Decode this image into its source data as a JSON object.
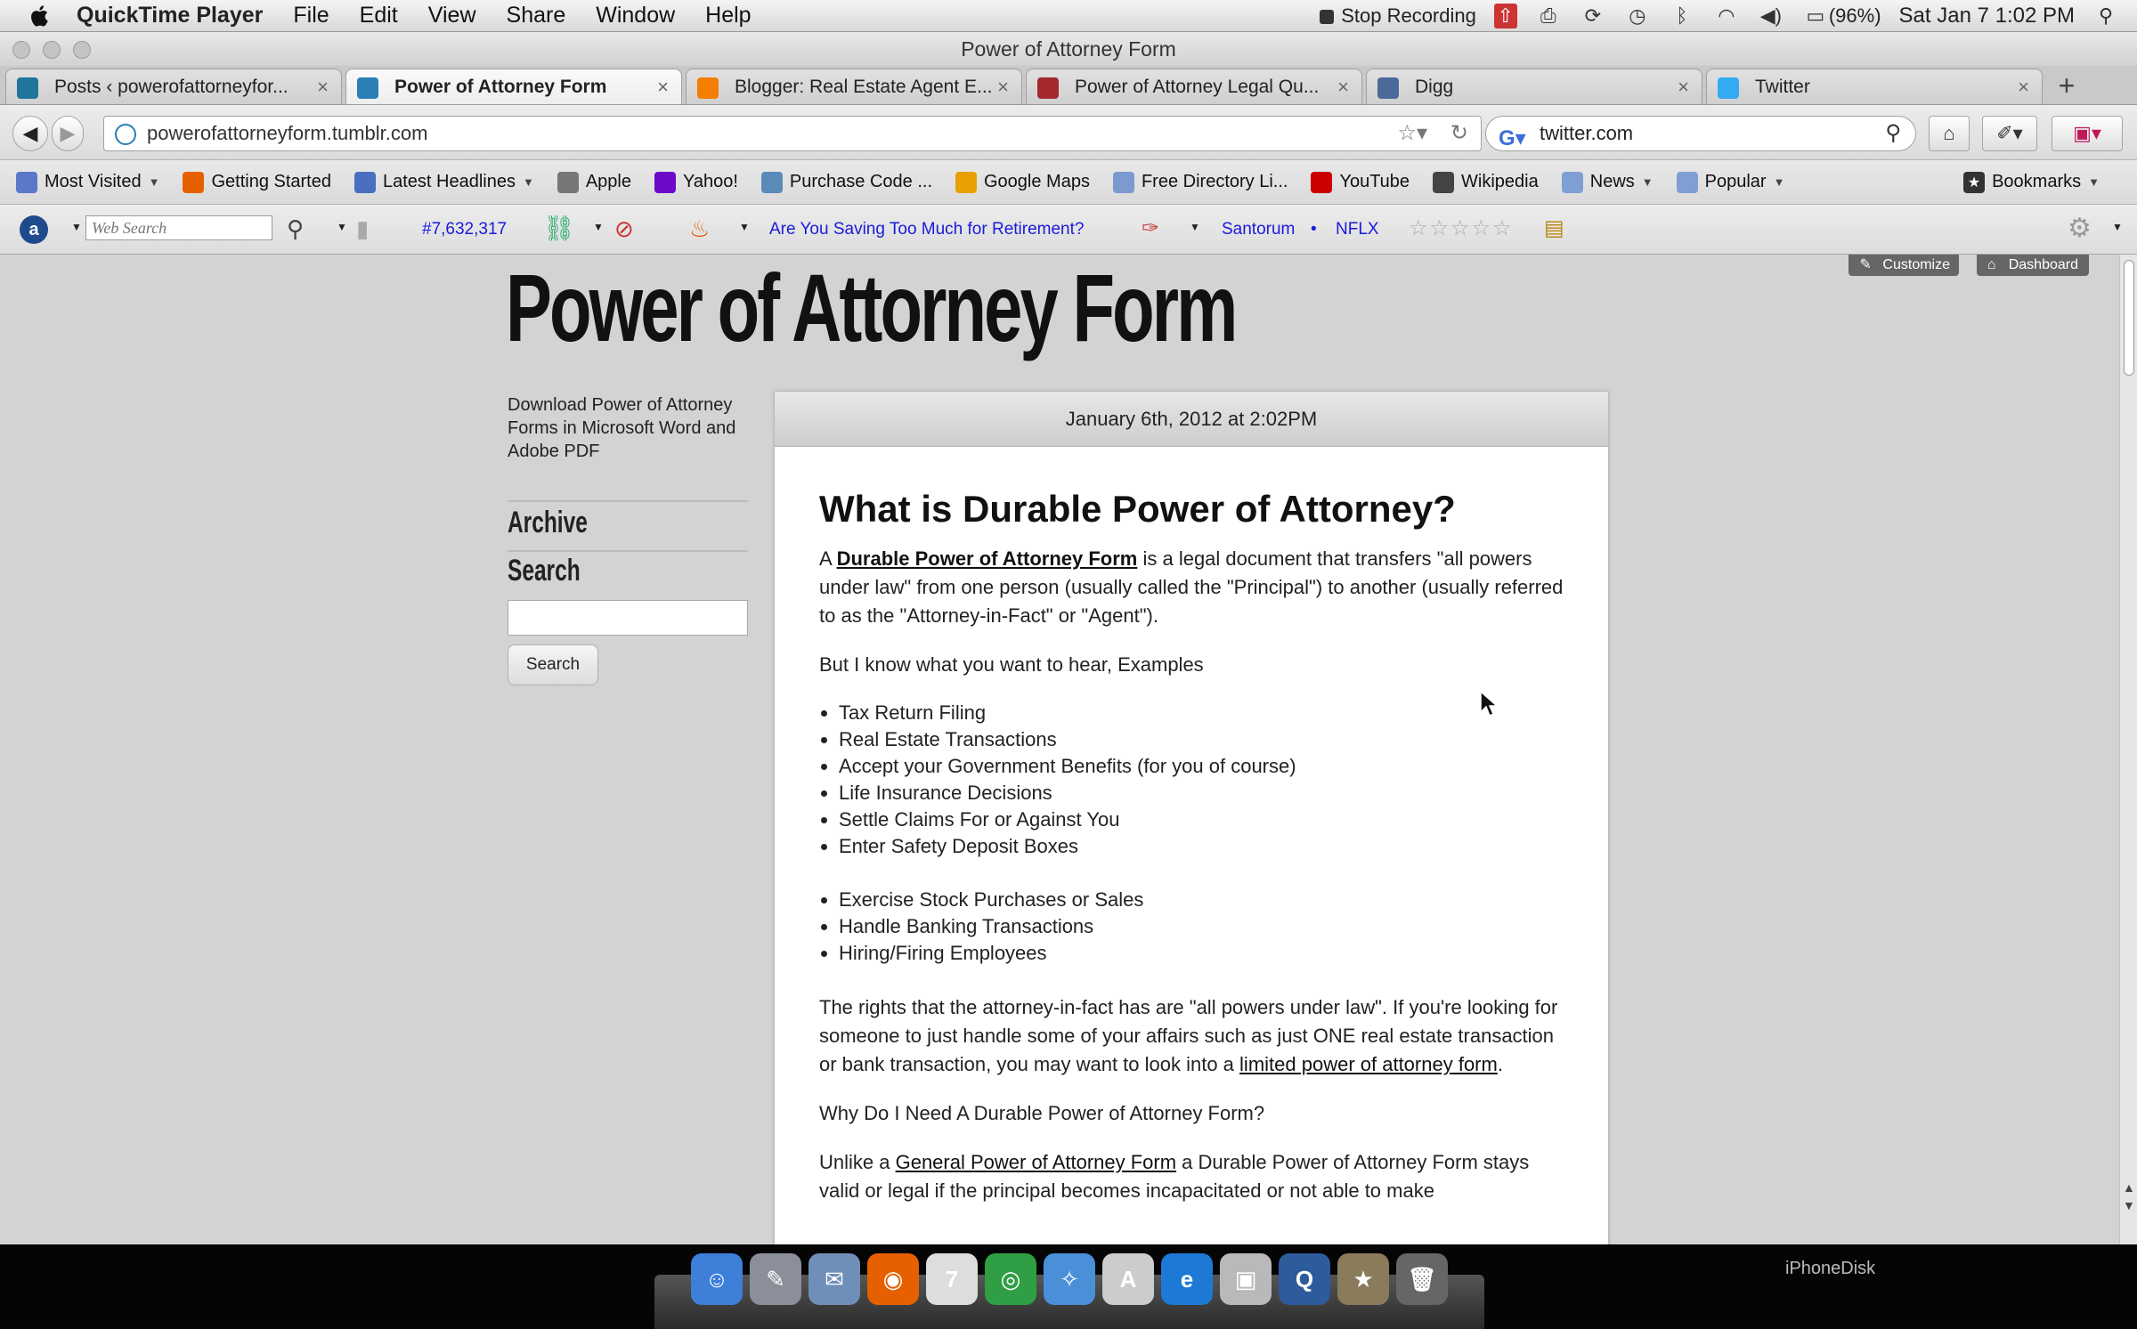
{
  "menubar": {
    "app": "QuickTime Player",
    "items": [
      "File",
      "Edit",
      "View",
      "Share",
      "Window",
      "Help"
    ],
    "stop_recording": "Stop Recording",
    "battery": "(96%)",
    "clock": "Sat Jan 7  1:02 PM"
  },
  "window": {
    "title": "Power of Attorney Form"
  },
  "tabs": [
    {
      "label": "Posts ‹ powerofattorneyfor...",
      "icon": "wordpress-icon",
      "color": "#21759b"
    },
    {
      "label": "Power of Attorney Form",
      "icon": "tumblr-loading-icon",
      "color": "#2a7fb5",
      "active": true
    },
    {
      "label": "Blogger: Real Estate Agent E...",
      "icon": "blogger-icon",
      "color": "#f57d00"
    },
    {
      "label": "Power of Attorney Legal Qu...",
      "icon": "legal-icon",
      "color": "#a4282c"
    },
    {
      "label": "Digg",
      "icon": "digg-icon",
      "color": "#4b6a9a"
    },
    {
      "label": "Twitter",
      "icon": "twitter-icon",
      "color": "#33aaf2"
    }
  ],
  "nav": {
    "url": "powerofattorneyform.tumblr.com",
    "search_value": "twitter.com"
  },
  "bookmarks": [
    {
      "label": "Most Visited",
      "icon": "most-visited-icon",
      "color": "#5a78c8",
      "dropdown": true
    },
    {
      "label": "Getting Started",
      "icon": "firefox-icon",
      "color": "#e66000",
      "dropdown": false
    },
    {
      "label": "Latest Headlines",
      "icon": "rss-icon",
      "color": "#4a6fc0",
      "dropdown": true
    },
    {
      "label": "Apple",
      "icon": "apple-icon",
      "color": "#777777",
      "dropdown": false
    },
    {
      "label": "Yahoo!",
      "icon": "yahoo-icon",
      "color": "#6b0ac9",
      "dropdown": false
    },
    {
      "label": "Purchase Code ...",
      "icon": "arrow-icon",
      "color": "#5a8ab8",
      "dropdown": false
    },
    {
      "label": "Google Maps",
      "icon": "map-pin-icon",
      "color": "#e8a000",
      "dropdown": false
    },
    {
      "label": "Free Directory Li...",
      "icon": "page-icon",
      "color": "#7a9ad0",
      "dropdown": false
    },
    {
      "label": "YouTube",
      "icon": "youtube-icon",
      "color": "#cc0000",
      "dropdown": false
    },
    {
      "label": "Wikipedia",
      "icon": "wikipedia-icon",
      "color": "#444444",
      "dropdown": false
    },
    {
      "label": "News",
      "icon": "folder-icon",
      "color": "#7f9fd3",
      "dropdown": true
    },
    {
      "label": "Popular",
      "icon": "folder-icon",
      "color": "#7f9fd3",
      "dropdown": true
    }
  ],
  "bookmarks_menu": "Bookmarks",
  "addonbar": {
    "search_placeholder": "Web Search",
    "rank": "#7,632,317",
    "ad_link": "Are You Saving Too Much for Retirement?",
    "link1": "Santorum",
    "link2": "NFLX",
    "rating": "☆☆☆☆☆"
  },
  "tumblr": {
    "customize": "Customize",
    "dashboard": "Dashboard"
  },
  "site": {
    "title": "Power of Attorney Form",
    "description": "Download Power of Attorney Forms in Microsoft Word and Adobe PDF",
    "archive": "Archive",
    "search_heading": "Search",
    "search_button": "Search"
  },
  "post": {
    "date": "January 6th, 2012 at 2:02PM",
    "heading": "What is Durable Power of Attorney?",
    "p1_a": "A ",
    "p1_link": "Durable Power of Attorney Form",
    "p1_b": " is a legal document that transfers \"all powers under law\" from one person (usually called the \"Principal\") to another (usually referred to as the \"Attorney-in-Fact\" or \"Agent\").",
    "p2": "But I know what you want to hear, Examples",
    "list1": [
      "Tax Return Filing",
      "Real Estate Transactions",
      "Accept your Government Benefits (for you of course)",
      "Life Insurance Decisions",
      "Settle Claims For or Against You",
      "Enter Safety Deposit Boxes"
    ],
    "list2": [
      "Exercise Stock Purchases or Sales",
      "Handle Banking Transactions",
      "Hiring/Firing Employees"
    ],
    "p3_a": "The rights that the attorney-in-fact has are \"all powers under law\". If you're looking for someone to just handle some of your affairs such as just ONE real estate transaction or bank transaction, you may want to look into a ",
    "p3_link": "limited power of attorney form",
    "p3_b": ".",
    "p4": "Why Do I Need A Durable Power of Attorney Form?",
    "p5_a": "Unlike a ",
    "p5_link": "General Power of Attorney Form",
    "p5_b": " a Durable Power of Attorney Form stays valid or legal if the principal becomes incapacitated or not able to make"
  },
  "dock": {
    "label": "iPhoneDisk",
    "icons": [
      {
        "name": "finder-icon",
        "color": "#3d7fd9",
        "glyph": "☺"
      },
      {
        "name": "preview-icon",
        "color": "#8a8f99",
        "glyph": "✎"
      },
      {
        "name": "mail-icon",
        "color": "#6f8fb8",
        "glyph": "✉"
      },
      {
        "name": "firefox-icon",
        "color": "#e66000",
        "glyph": "◉"
      },
      {
        "name": "ical-icon",
        "color": "#dddddd",
        "glyph": "7"
      },
      {
        "name": "chrome-icon",
        "color": "#2f9e44",
        "glyph": "◎"
      },
      {
        "name": "safari-icon",
        "color": "#4a90d9",
        "glyph": "✧"
      },
      {
        "name": "acrobat-icon",
        "color": "#cccccc",
        "glyph": "A"
      },
      {
        "name": "internet-explorer-icon",
        "color": "#1c7ad6",
        "glyph": "e"
      },
      {
        "name": "photos-icon",
        "color": "#b9b9b9",
        "glyph": "▣"
      },
      {
        "name": "quicktime-icon",
        "color": "#2d5b9c",
        "glyph": "Q"
      },
      {
        "name": "imovie-icon",
        "color": "#8a7b5a",
        "glyph": "★"
      },
      {
        "name": "trash-icon",
        "color": "#666666",
        "glyph": "🗑"
      }
    ]
  }
}
